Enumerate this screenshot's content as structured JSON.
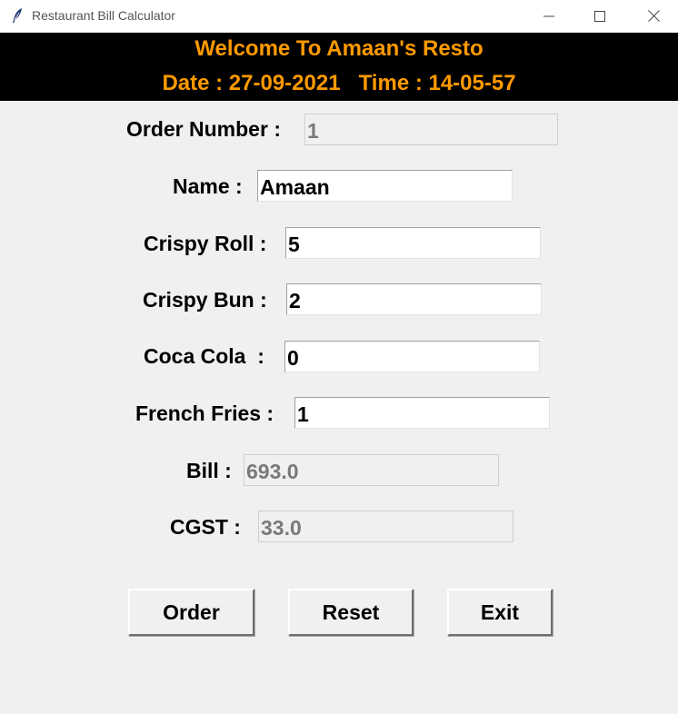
{
  "window": {
    "title": "Restaurant Bill Calculator",
    "icon": "feather-icon"
  },
  "banner": {
    "welcome": "Welcome To Amaan's Resto",
    "date_text": "Date : 27-09-2021",
    "time_text": "Time : 14-05-57",
    "text_color": "#ff9a00",
    "background": "#000000"
  },
  "form": {
    "order_number": {
      "label": "Order Number :",
      "value": "1"
    },
    "name": {
      "label": "Name :",
      "value": "Amaan"
    },
    "crispy_roll": {
      "label": "Crispy Roll :",
      "value": "5"
    },
    "crispy_bun": {
      "label": "Crispy Bun :",
      "value": "2"
    },
    "coca_cola": {
      "label": "Coca Cola  :",
      "value": "0"
    },
    "french_fries": {
      "label": "French Fries :",
      "value": "1"
    },
    "bill": {
      "label": "Bill :",
      "value": "693.0"
    },
    "cgst": {
      "label": "CGST :",
      "value": "33.0"
    }
  },
  "buttons": {
    "order": "Order",
    "reset": "Reset",
    "exit": "Exit"
  }
}
